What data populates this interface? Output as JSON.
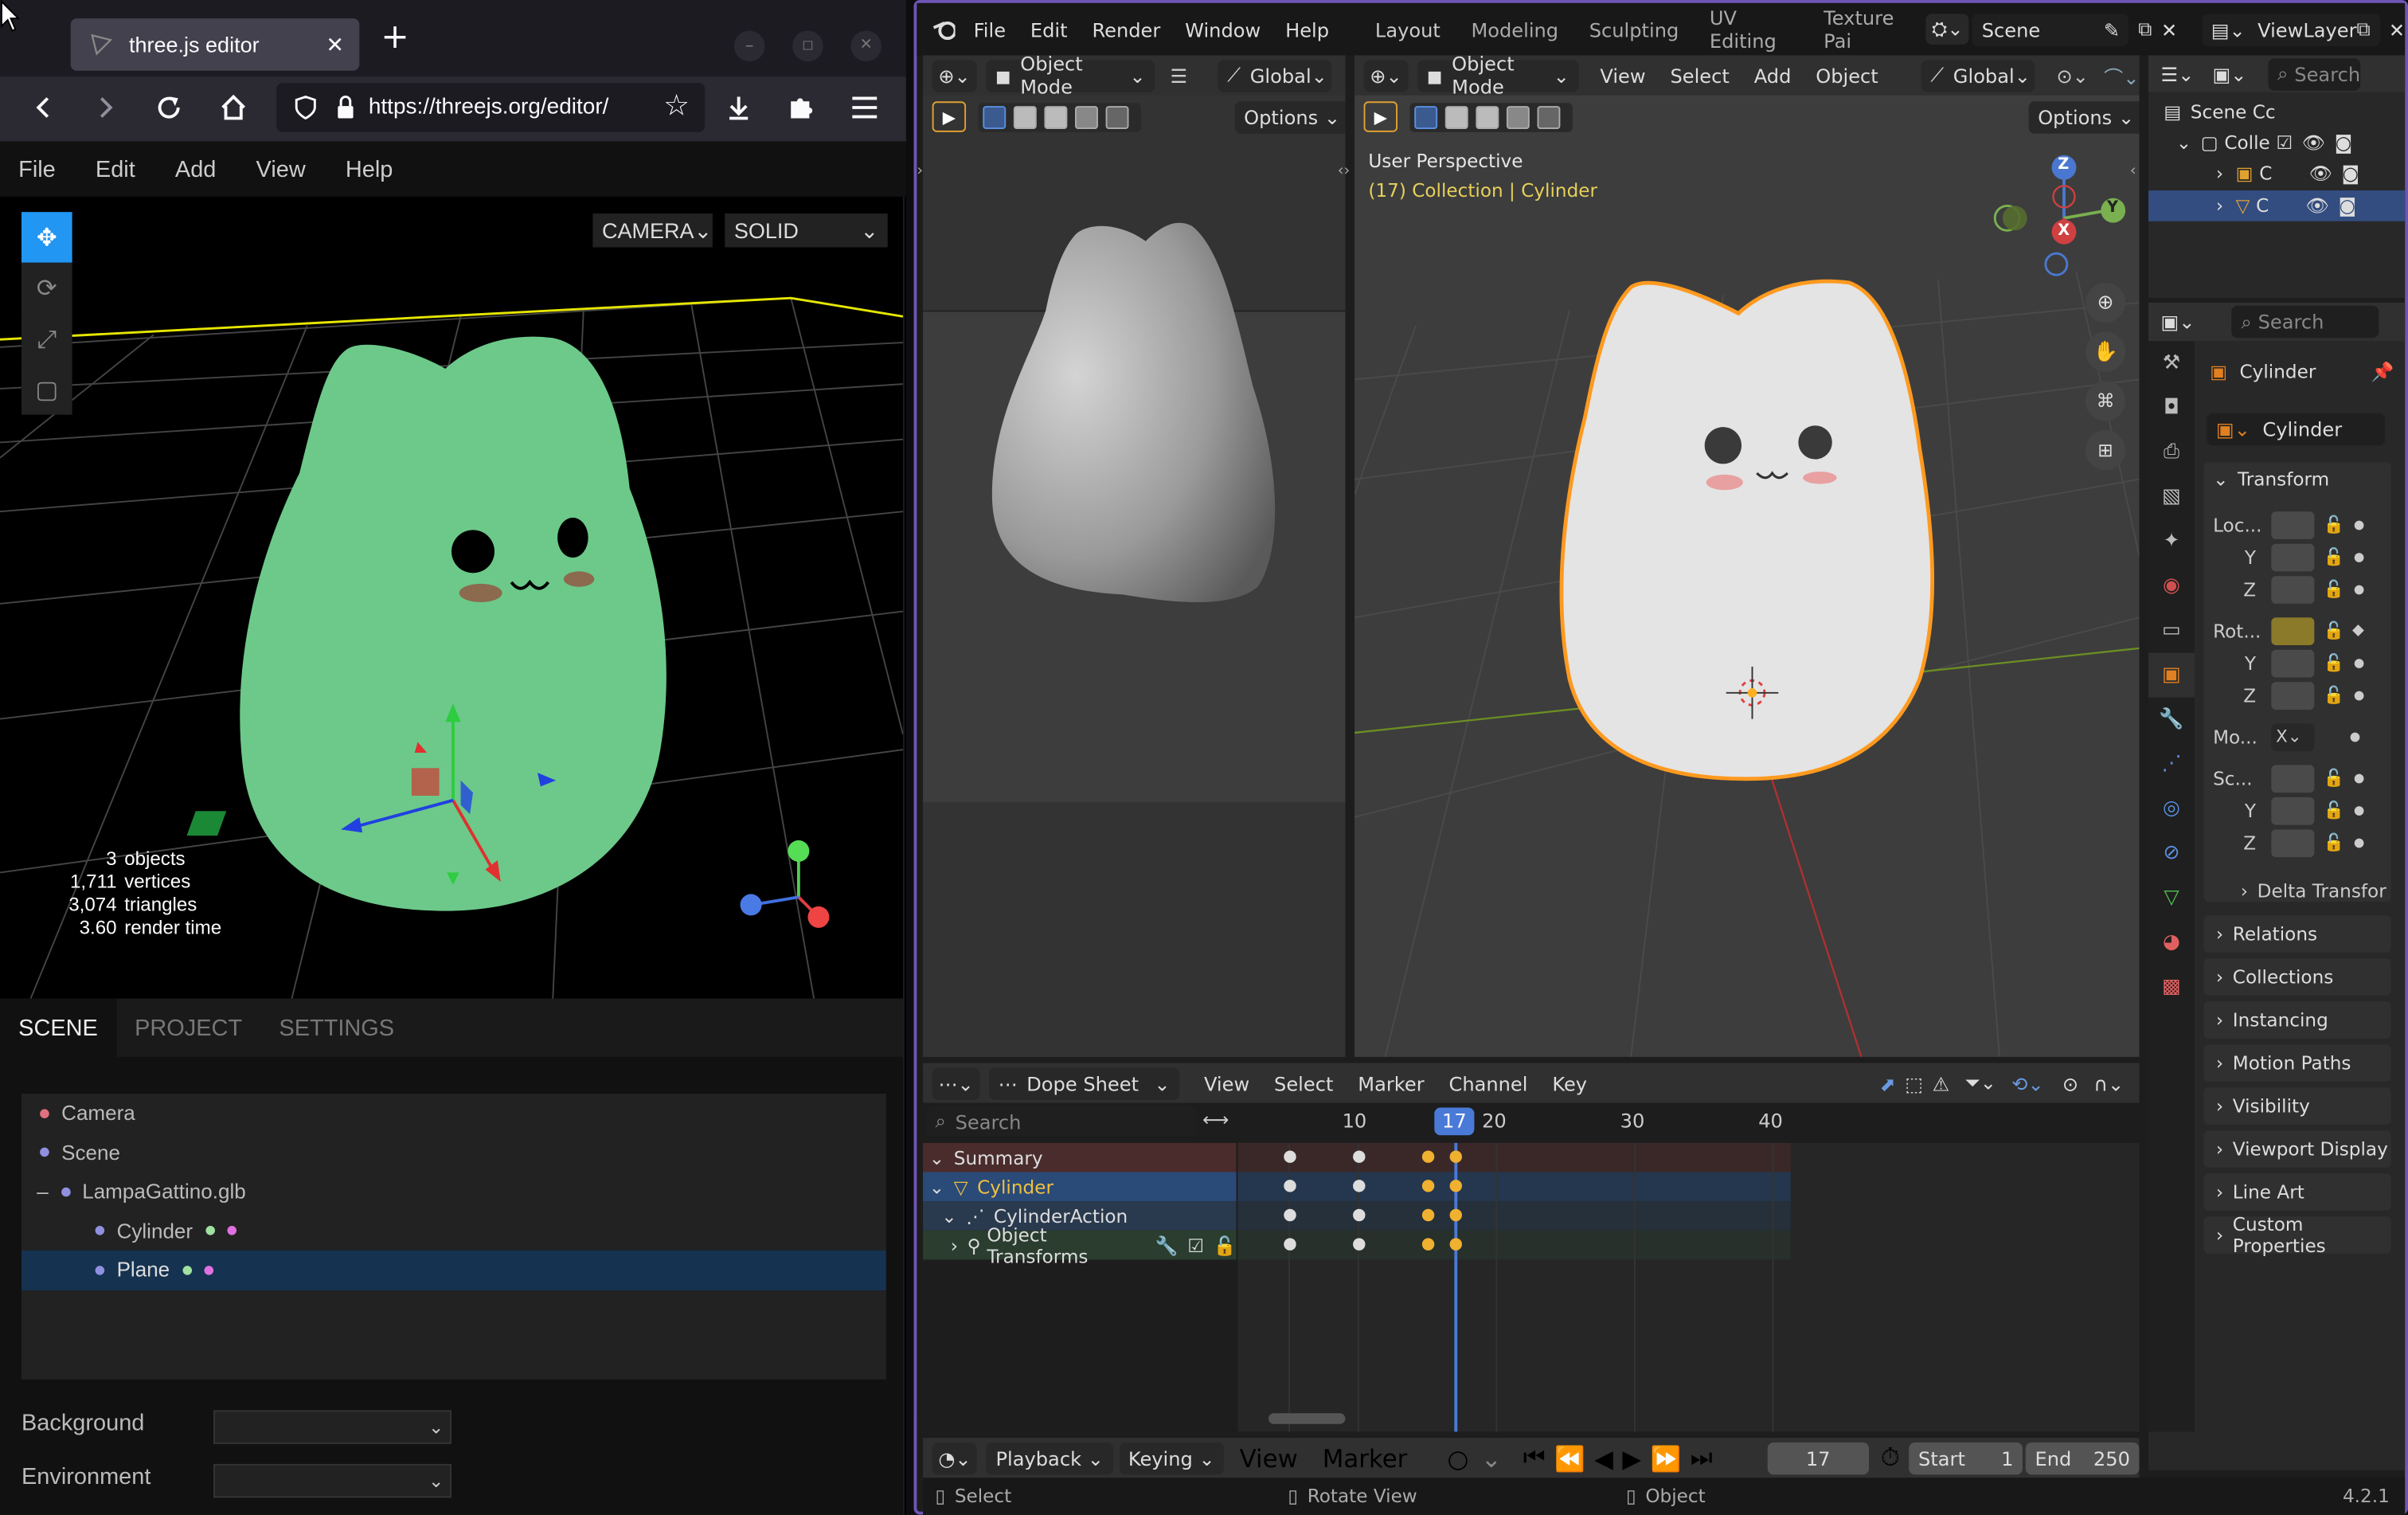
{
  "firefox": {
    "tab_title": "three.js editor",
    "url": "https://threejs.org/editor/",
    "icons": [
      "back-icon",
      "forward-icon",
      "reload-icon",
      "home-icon",
      "shield-icon",
      "lock-icon",
      "star-icon",
      "download-icon",
      "extension-icon",
      "hamburger-icon"
    ]
  },
  "threejs": {
    "menu": [
      "File",
      "Edit",
      "Add",
      "View",
      "Help"
    ],
    "camera_select": "CAMERA",
    "shading_select": "SOLID",
    "stats": [
      {
        "value": "3",
        "label": "objects"
      },
      {
        "value": "1,711",
        "label": "vertices"
      },
      {
        "value": "3,074",
        "label": "triangles"
      },
      {
        "value": "3.60",
        "label": "render time"
      }
    ],
    "panel_tabs": [
      "SCENE",
      "PROJECT",
      "SETTINGS"
    ],
    "outliner": [
      {
        "name": "Camera"
      },
      {
        "name": "Scene"
      },
      {
        "name": "LampaGattino.glb",
        "toggle": "–"
      },
      {
        "name": "Cylinder"
      },
      {
        "name": "Plane",
        "selected": true
      }
    ],
    "background_label": "Background",
    "environment_label": "Environment"
  },
  "blender": {
    "menu": [
      "File",
      "Edit",
      "Render",
      "Window",
      "Help"
    ],
    "workspaces": [
      "Layout",
      "Modeling",
      "Sculpting",
      "UV Editing",
      "Texture Pai"
    ],
    "scene": "Scene",
    "view_layer": "ViewLayer",
    "vp1": {
      "mode": "Object Mode",
      "orientation": "Global",
      "options": "Options"
    },
    "vp2": {
      "mode": "Object Mode",
      "menus": [
        "View",
        "Select",
        "Add",
        "Object"
      ],
      "orientation": "Global",
      "options": "Options",
      "title": "User Perspective",
      "subtitle": "(17) Collection | Cylinder"
    },
    "gizmo": {
      "z": "Z",
      "y": "Y",
      "x": "X"
    },
    "outliner": {
      "search": "Search",
      "scene_collection": "Scene Cc",
      "collection": "Colle",
      "item1": "C",
      "item2": "C"
    },
    "properties": {
      "search": "Search",
      "object": "Cylinder",
      "object_data": "Cylinder",
      "transform": "Transform",
      "loc": "Loc...",
      "rot": "Rot...",
      "mode": "Mo...",
      "mode_value": "X",
      "scale": "Sc...",
      "axes": [
        "Y",
        "Z"
      ],
      "delta": "Delta Transfor",
      "panels": [
        "Relations",
        "Collections",
        "Instancing",
        "Motion Paths",
        "Visibility",
        "Viewport Display",
        "Line Art",
        "Custom Properties"
      ]
    },
    "dopesheet": {
      "editor": "Dope Sheet",
      "menus": [
        "View",
        "Select",
        "Marker",
        "Channel",
        "Key"
      ],
      "search": "Search",
      "frames": [
        "10",
        "20",
        "30",
        "40"
      ],
      "current_frame": "17",
      "channels": [
        "Summary",
        "Cylinder",
        "CylinderAction",
        "Object Transforms"
      ]
    },
    "timeline": {
      "menus": [
        "Playback",
        "Keying",
        "View",
        "Marker"
      ],
      "frame": "17",
      "start_label": "Start",
      "start": "1",
      "end_label": "End",
      "end": "250"
    },
    "status": {
      "select": "Select",
      "rotate": "Rotate View",
      "object": "Object",
      "version": "4.2.1"
    }
  }
}
